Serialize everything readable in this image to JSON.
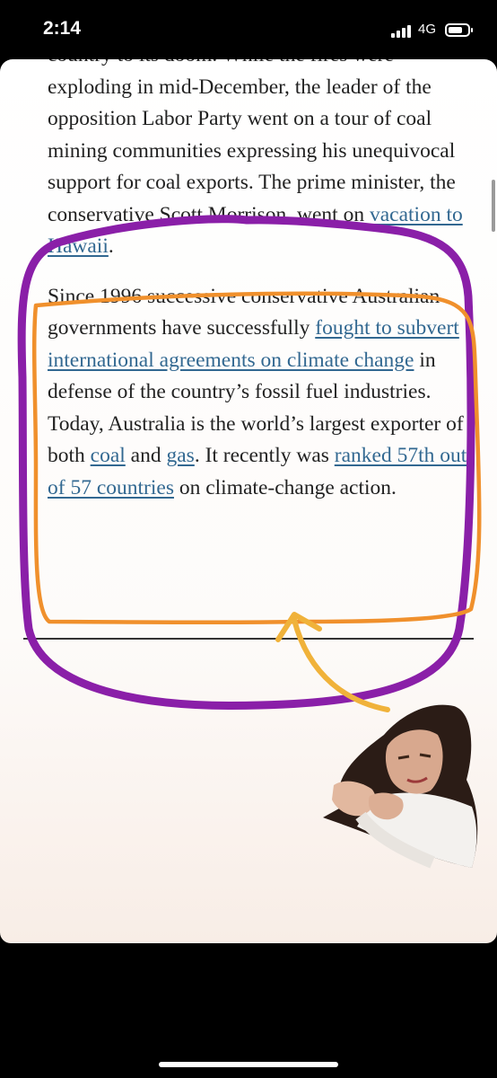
{
  "status_bar": {
    "time": "2:14",
    "network": "4G"
  },
  "article": {
    "para1": {
      "cut_line": "country to its doom. While the fires were",
      "text": "exploding in mid-December, the leader of the opposition Labor Party went on a tour of coal mining communities expressing his unequivocal support for coal exports. The prime minister, the conservative Scott Morrison, went on ",
      "link_hawaii": "vacation to Hawaii",
      "end": "."
    },
    "para2": {
      "t1": "Since 1996 successive conservative Australian governments have successfully ",
      "link_subvert": "fought to subvert international agreements on climate change",
      "t2": " in defense of the country’s fossil fuel industries. Today, Australia is the world’s largest exporter of both ",
      "link_coal": "coal",
      "t3": " and ",
      "link_gas": "gas",
      "t4": ". It recently was ",
      "link_ranked": "ranked 57th out of 57 countries",
      "t5": " on climate-change action."
    }
  },
  "annotations": {
    "purple_color": "#8a1fa8",
    "orange_color": "#f0902c",
    "arrow_color": "#f0b23a"
  }
}
